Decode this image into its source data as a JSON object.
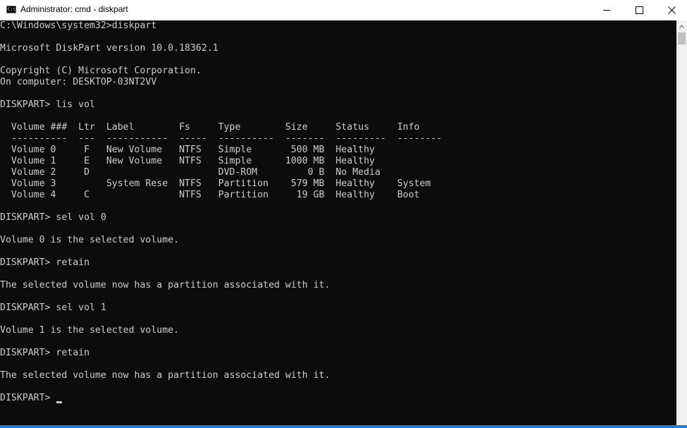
{
  "window": {
    "title": "Administrator: cmd - diskpart",
    "icon_text": "C:\\",
    "icon": "cmd-icon",
    "controls": [
      "minimize-icon",
      "maximize-icon",
      "close-icon"
    ]
  },
  "console": {
    "lines": [
      "C:\\Windows\\system32>diskpart",
      "",
      "Microsoft DiskPart version 10.0.18362.1",
      "",
      "Copyright (C) Microsoft Corporation.",
      "On computer: DESKTOP-03NT2VV",
      "",
      "DISKPART> lis vol",
      "",
      "  Volume ###  Ltr  Label        Fs     Type        Size     Status     Info",
      "  ----------  ---  -----------  -----  ----------  -------  ---------  --------",
      "  Volume 0     F   New Volume   NTFS   Simple       500 MB  Healthy",
      "  Volume 1     E   New Volume   NTFS   Simple      1000 MB  Healthy",
      "  Volume 2     D                       DVD-ROM         0 B  No Media",
      "  Volume 3         System Rese  NTFS   Partition    579 MB  Healthy    System",
      "  Volume 4     C                NTFS   Partition     19 GB  Healthy    Boot",
      "",
      "DISKPART> sel vol 0",
      "",
      "Volume 0 is the selected volume.",
      "",
      "DISKPART> retain",
      "",
      "The selected volume now has a partition associated with it.",
      "",
      "DISKPART> sel vol 1",
      "",
      "Volume 1 is the selected volume.",
      "",
      "DISKPART> retain",
      "",
      "The selected volume now has a partition associated with it.",
      "",
      "DISKPART> "
    ]
  },
  "colors": {
    "console_background": "#0c0c0c",
    "console_text": "#cccccc",
    "titlebar_background": "#ffffff"
  }
}
